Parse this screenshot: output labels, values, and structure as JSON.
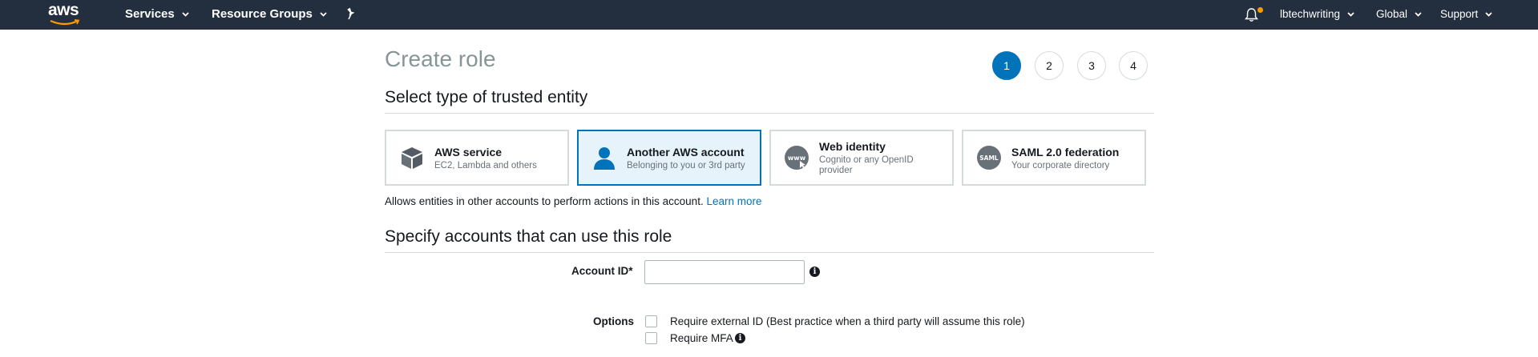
{
  "topnav": {
    "logo_text": "aws",
    "services": "Services",
    "resource_groups": "Resource Groups",
    "user": "lbtechwriting",
    "region": "Global",
    "support": "Support",
    "accent_color": "#ff9900",
    "bg_color": "#232f3e"
  },
  "page": {
    "title": "Create role",
    "steps": [
      "1",
      "2",
      "3",
      "4"
    ],
    "active_step": "1"
  },
  "trusted_entity": {
    "heading": "Select type of trusted entity",
    "tiles": [
      {
        "title": "AWS service",
        "subtitle": "EC2, Lambda and others",
        "icon": "cube-icon"
      },
      {
        "title": "Another AWS account",
        "subtitle": "Belonging to you or 3rd party",
        "icon": "user-icon"
      },
      {
        "title": "Web identity",
        "subtitle": "Cognito or any OpenID provider",
        "icon": "www-icon"
      },
      {
        "title": "SAML 2.0 federation",
        "subtitle": "Your corporate directory",
        "icon": "saml-icon"
      }
    ],
    "selected": "Another AWS account",
    "description": "Allows entities in other accounts to perform actions in this account.",
    "learn_more": "Learn more"
  },
  "accounts": {
    "heading": "Specify accounts that can use this role",
    "account_id_label": "Account ID*",
    "account_id_value": "",
    "options_label": "Options",
    "option_external_id": "Require external ID (Best practice when a third party will assume this role)",
    "option_mfa": "Require MFA"
  }
}
